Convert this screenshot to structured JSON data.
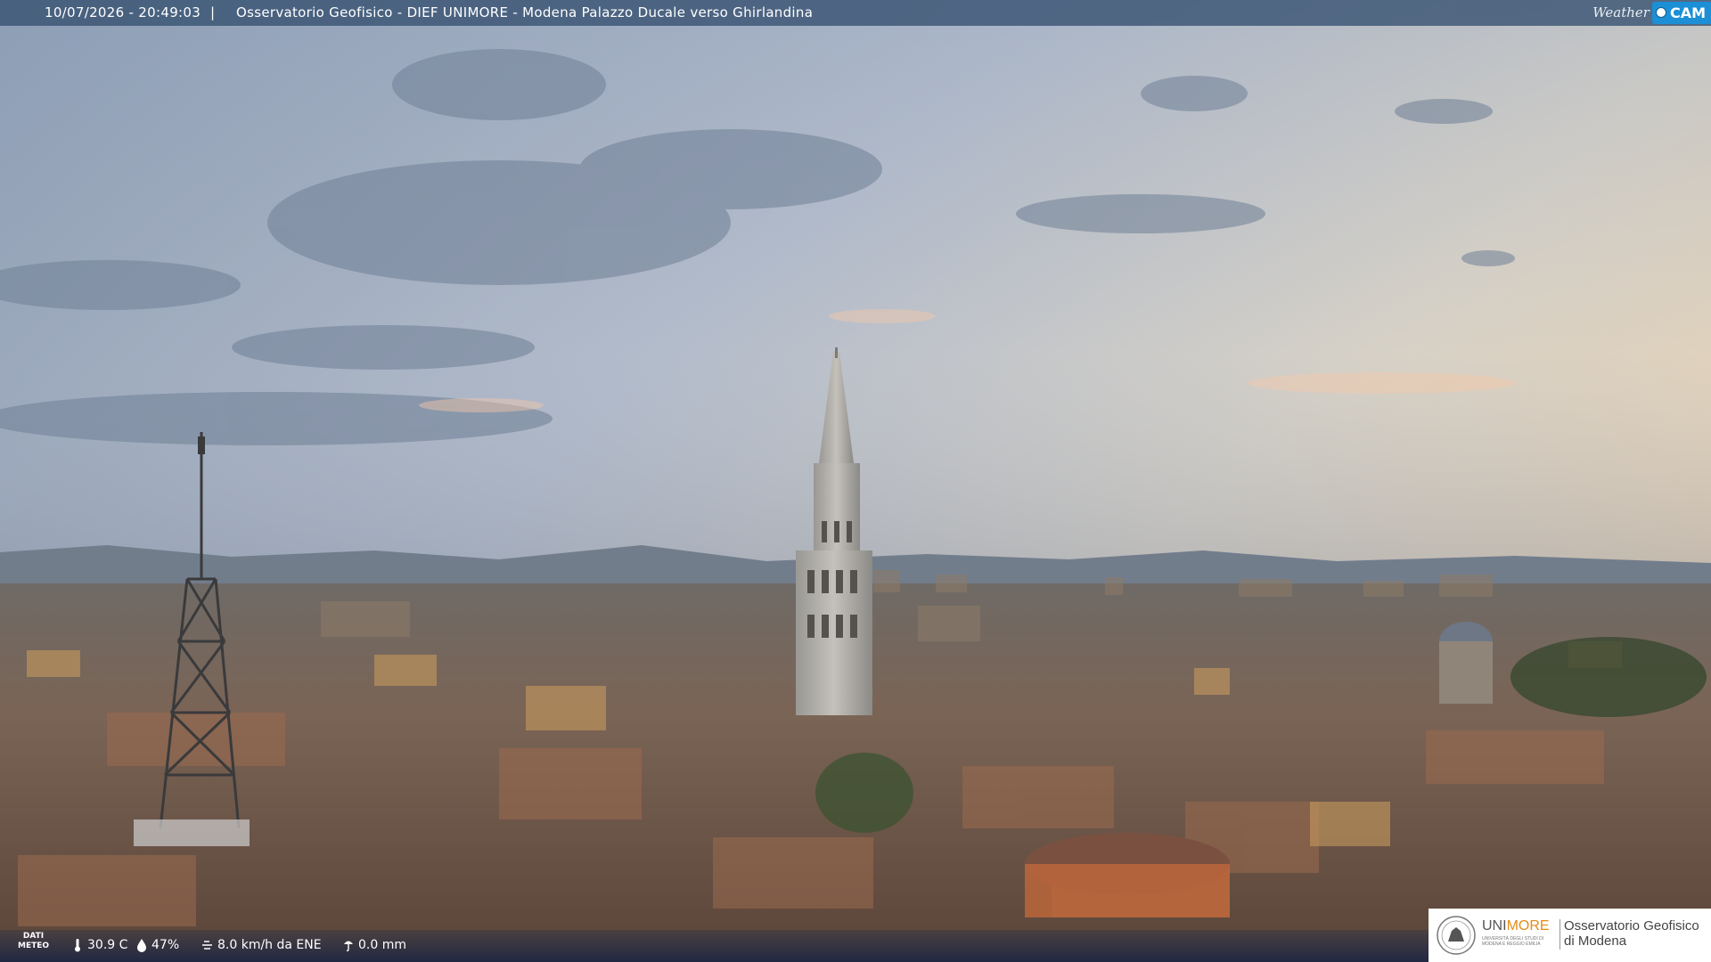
{
  "header": {
    "datetime": "10/07/2026 - 20:49:03",
    "separator": "|",
    "title": "Osservatorio Geofisico - DIEF UNIMORE - Modena Palazzo Ducale verso Ghirlandina",
    "logo_weather": "Weather",
    "logo_cam": "CAM"
  },
  "weather": {
    "label_line1": "DATI",
    "label_line2": "METEO",
    "temperature": "30.9 C",
    "humidity": "47%",
    "wind": "8.0 km/h da ENE",
    "rain": "0.0 mm"
  },
  "icons": {
    "temperature": "thermometer-icon",
    "humidity": "droplet-icon",
    "wind": "wind-icon",
    "rain": "rain-icon"
  },
  "branding": {
    "uni_prefix": "UNI",
    "uni_suffix": "MORE",
    "uni_sub": "UNIVERSITÀ DEGLI STUDI DI MODENA E REGGIO EMILIA",
    "obs_line1": "Osservatorio Geofisico",
    "obs_line2": "di Modena"
  },
  "colors": {
    "header_bar": "#345070",
    "cam_badge": "#1c8fd6",
    "uni_accent": "#e38c17"
  }
}
